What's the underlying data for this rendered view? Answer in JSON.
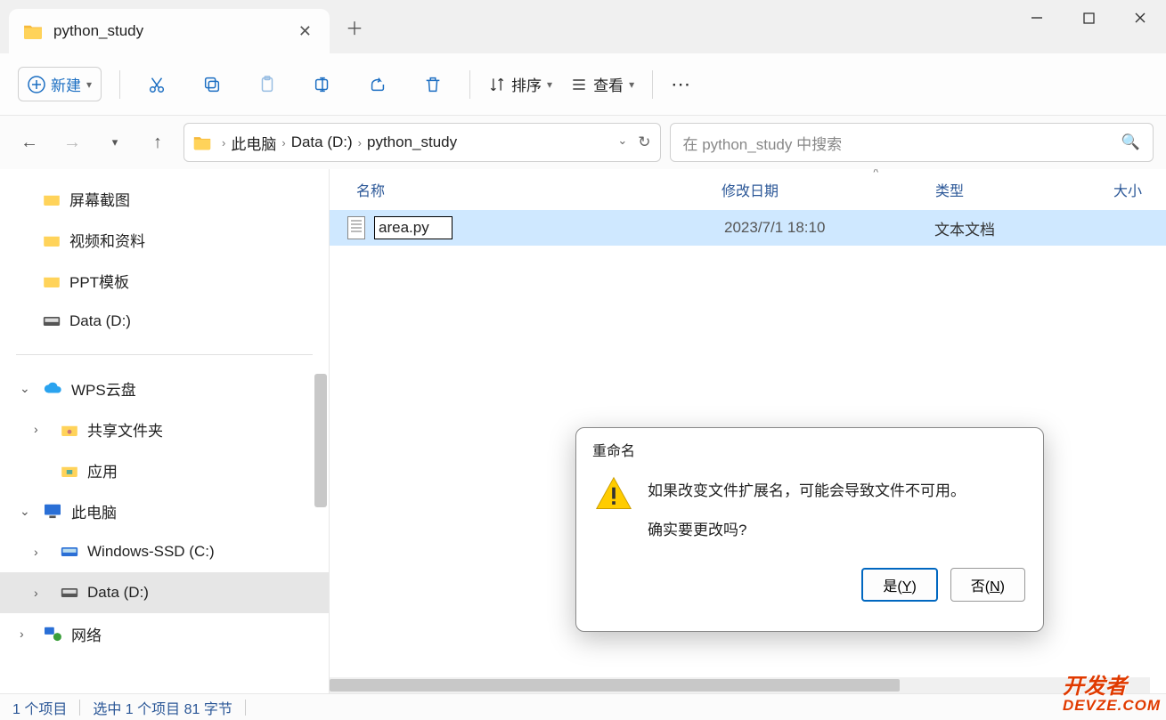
{
  "tab": {
    "title": "python_study"
  },
  "toolbar": {
    "new_label": "新建",
    "sort_label": "排序",
    "view_label": "查看"
  },
  "breadcrumb": {
    "root": "此电脑",
    "drive": "Data (D:)",
    "folder": "python_study"
  },
  "search": {
    "placeholder": "在 python_study 中搜索"
  },
  "sidebar": {
    "quick": [
      "屏幕截图",
      "视频和资料",
      "PPT模板",
      "Data (D:)"
    ],
    "wps": {
      "label": "WPS云盘",
      "items": [
        "共享文件夹",
        "应用"
      ]
    },
    "pc": {
      "label": "此电脑",
      "items": [
        "Windows-SSD (C:)",
        "Data (D:)"
      ]
    },
    "network": "网络"
  },
  "columns": {
    "name": "名称",
    "modified": "修改日期",
    "type": "类型",
    "size": "大小"
  },
  "files": [
    {
      "name": "area.py",
      "modified": "2023/7/1 18:10",
      "type": "文本文档"
    }
  ],
  "status": {
    "count": "1 个项目",
    "selected": "选中 1 个项目 81 字节"
  },
  "dialog": {
    "title": "重命名",
    "line1": "如果改变文件扩展名，可能会导致文件不可用。",
    "line2": "确实要更改吗?",
    "yes_prefix": "是(",
    "yes_key": "Y",
    "yes_suffix": ")",
    "no_prefix": "否(",
    "no_key": "N",
    "no_suffix": ")"
  },
  "watermark": {
    "l1": "开发者",
    "l2": "DEVZE.COM"
  }
}
